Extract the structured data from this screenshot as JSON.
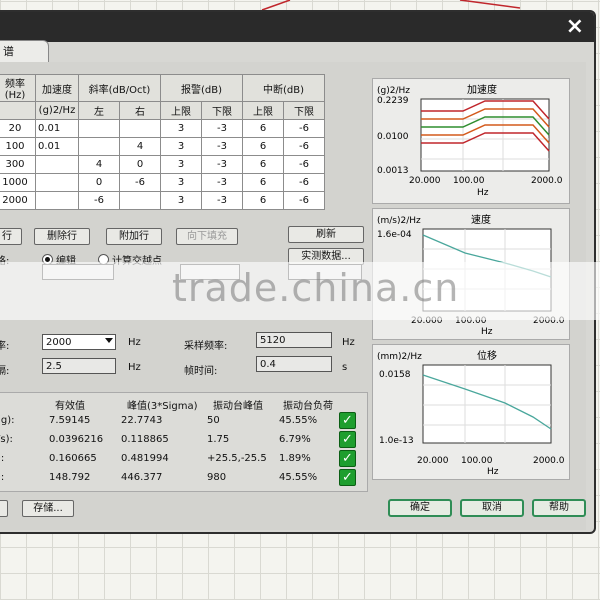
{
  "window": {
    "tab_label": "谱",
    "close_glyph": "×"
  },
  "table": {
    "headers_top": [
      "频率(Hz)",
      "加速度",
      "斜率(dB/Oct)",
      "报警(dB)",
      "中断(dB)"
    ],
    "accel_unit": "(g)2/Hz",
    "sub_headers": [
      "左",
      "右",
      "上限",
      "下限",
      "上限",
      "下限"
    ],
    "rows": [
      [
        "20",
        "0.01",
        "",
        "",
        "3",
        "-3",
        "6",
        "-6"
      ],
      [
        "100",
        "0.01",
        "",
        "4",
        "3",
        "-3",
        "6",
        "-6"
      ],
      [
        "300",
        "",
        "4",
        "0",
        "3",
        "-3",
        "6",
        "-6"
      ],
      [
        "1000",
        "",
        "0",
        "-6",
        "3",
        "-3",
        "6",
        "-6"
      ],
      [
        "2000",
        "",
        "-6",
        "",
        "3",
        "-3",
        "6",
        "-6"
      ]
    ]
  },
  "buttons": {
    "insert_row": "行",
    "delete_row": "删除行",
    "append_row": "附加行",
    "fill_down": "向下填充",
    "refresh": "刷新",
    "measured_data": "实测数据...",
    "save": "存储...",
    "ok": "确定",
    "cancel": "取消",
    "help": "帮助"
  },
  "mode": {
    "label": "格:",
    "edit": "编辑",
    "calc_cross": "计算交越点"
  },
  "params": {
    "freq_label": "率:",
    "freq_value": "2000",
    "freq_unit": "Hz",
    "sample_rate_label": "采样频率:",
    "sample_rate_value": "5120",
    "sample_rate_unit": "Hz",
    "resolution_label": "隔:",
    "resolution_value": "2.5",
    "resolution_unit": "Hz",
    "frame_time_label": "帧时间:",
    "frame_time_value": "0.4",
    "frame_time_unit": "s"
  },
  "results": {
    "headers": [
      "有效值",
      "峰值(3*Sigma)",
      "振动台峰值",
      "振动台负荷"
    ],
    "rows": [
      {
        "unit": "(g):",
        "rms": "7.59145",
        "peak": "22.7743",
        "table_peak": "50",
        "load": "45.55%"
      },
      {
        "unit": "/s):",
        "rms": "0.0396216",
        "peak": "0.118865",
        "table_peak": "1.75",
        "load": "6.79%"
      },
      {
        "unit": "):",
        "rms": "0.160665",
        "peak": "0.481994",
        "table_peak": "+25.5,-25.5",
        "load": "1.89%"
      },
      {
        "unit": "):",
        "rms": "148.792",
        "peak": "446.377",
        "table_peak": "980",
        "load": "45.55%"
      }
    ]
  },
  "charts": [
    {
      "ylabel": "(g)2/Hz",
      "title": "加速度",
      "yticks": [
        "0.2239",
        "0.0100",
        "0.0013"
      ],
      "xticks": [
        "20.000",
        "100.00",
        "2000.0"
      ],
      "xunit": "Hz"
    },
    {
      "ylabel": "(m/s)2/Hz",
      "title": "速度",
      "yticks": [
        "1.6e-04"
      ],
      "xticks": [
        "20.000",
        "100.00",
        "2000.0"
      ],
      "xunit": "Hz"
    },
    {
      "ylabel": "(mm)2/Hz",
      "title": "位移",
      "yticks": [
        "0.0158",
        "1.0e-13"
      ],
      "xticks": [
        "20.000",
        "100.00",
        "2000.0"
      ],
      "xunit": "Hz"
    }
  ],
  "watermark": "trade.china.cn",
  "colors": {
    "check_green": "#1e9e2e",
    "limit_red": "#c0262c",
    "trace_teal": "#4aa79c"
  }
}
